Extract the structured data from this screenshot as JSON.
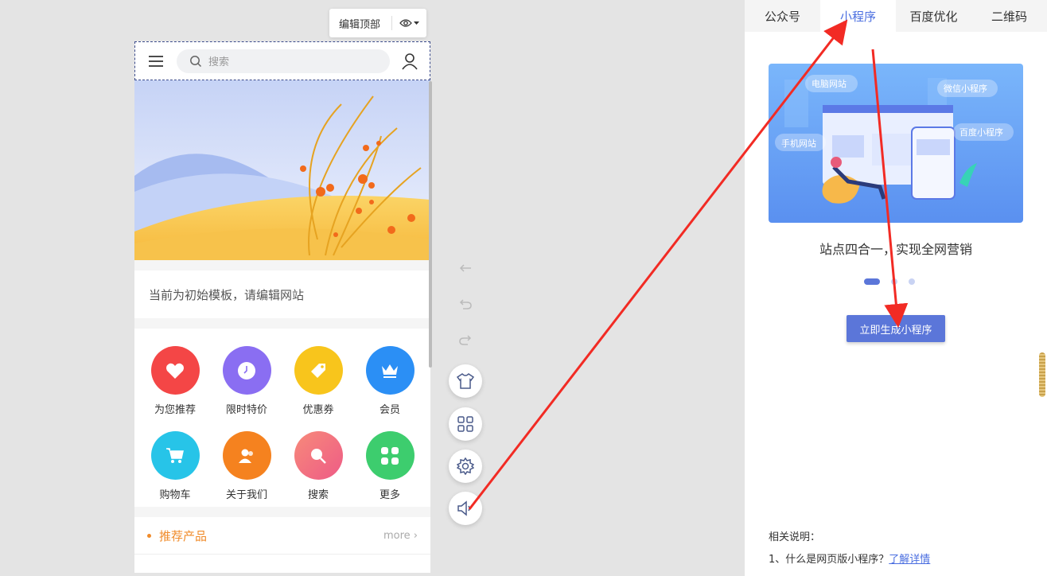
{
  "toolbar": {
    "edit_label": "编辑顶部",
    "icon": "eye-icon"
  },
  "phone": {
    "search_placeholder": "搜索",
    "notice": "当前为初始模板，请编辑网站",
    "grid": [
      {
        "label": "为您推荐",
        "icon": "heart-icon",
        "color": "#f44646"
      },
      {
        "label": "限时特价",
        "icon": "clock-icon",
        "color": "#8a6ef2"
      },
      {
        "label": "优惠券",
        "icon": "tag-icon",
        "color": "#f8c51c"
      },
      {
        "label": "会员",
        "icon": "crown-icon",
        "color": "#2b8ff5"
      },
      {
        "label": "购物车",
        "icon": "cart-icon",
        "color": "#27c4e8"
      },
      {
        "label": "关于我们",
        "icon": "people-icon",
        "color": "#f5821f"
      },
      {
        "label": "搜索",
        "icon": "search-icon",
        "color": "#f06b73"
      },
      {
        "label": "更多",
        "icon": "apps-icon",
        "color": "#3dcd6e"
      }
    ],
    "products_title": "推荐产品",
    "products_more": "more"
  },
  "tools": [
    "undo-icon",
    "redo-icon",
    "shirt-icon",
    "layout-icon",
    "settings-icon",
    "speaker-icon"
  ],
  "panel": {
    "tabs": [
      "公众号",
      "小程序",
      "百度优化",
      "二维码"
    ],
    "active_tab": "小程序",
    "promo_tags": [
      "电脑网站",
      "微信小程序",
      "手机网站",
      "百度小程序"
    ],
    "slogan": "站点四合一，实现全网营销",
    "generate_button": "立即生成小程序",
    "notes_title": "相关说明：",
    "note_1": "1、什么是网页版小程序？",
    "note_1_link": "了解详情"
  },
  "colors": {
    "accent": "#5b76d9",
    "annotation_arrow": "#f22b24",
    "product_title": "#f08b2a"
  }
}
